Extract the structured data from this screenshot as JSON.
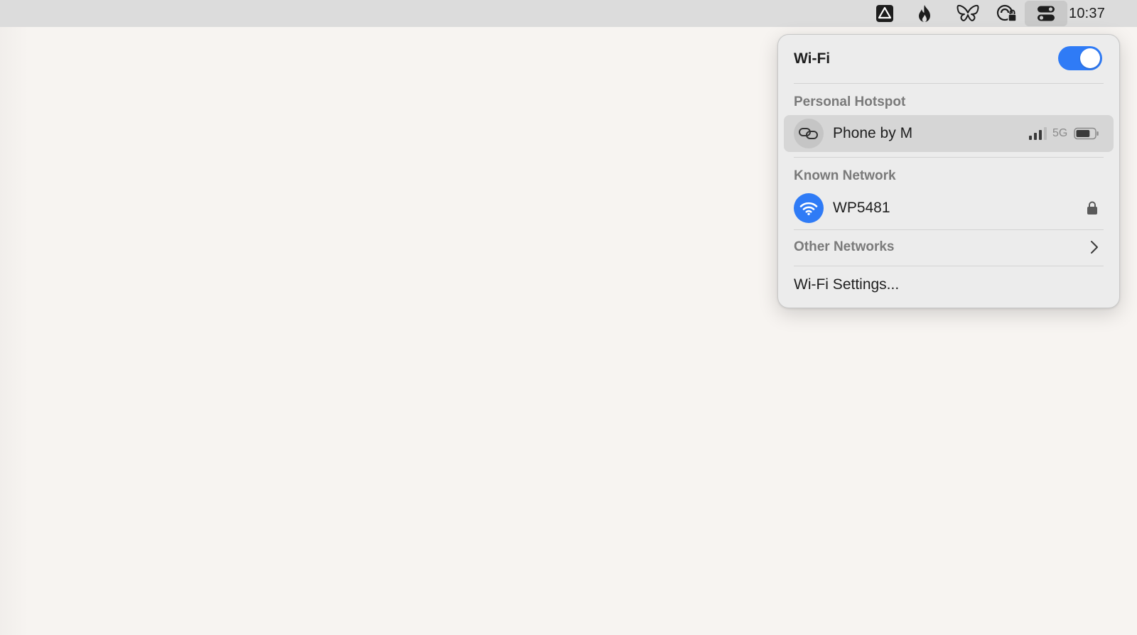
{
  "menubar": {
    "status_icons": [
      {
        "name": "drive-icon"
      },
      {
        "name": "flame-icon"
      },
      {
        "name": "butterfly-icon"
      },
      {
        "name": "cloud-lock-icon"
      },
      {
        "name": "control-center-icon"
      }
    ],
    "clock": "10:37"
  },
  "wifi_panel": {
    "title": "Wi-Fi",
    "enabled": true,
    "accent_color": "#2f7bf6",
    "personal_hotspot": {
      "section_label": "Personal Hotspot",
      "device": {
        "name": "Phone by M",
        "icon": "link-icon",
        "signal_bars": 3,
        "network_type": "5G",
        "battery_level": 0.75
      }
    },
    "known_network": {
      "section_label": "Known Network",
      "network": {
        "name": "WP5481",
        "icon": "wifi-icon",
        "secured": true
      }
    },
    "other_networks_label": "Other Networks",
    "settings_label": "Wi-Fi Settings..."
  }
}
